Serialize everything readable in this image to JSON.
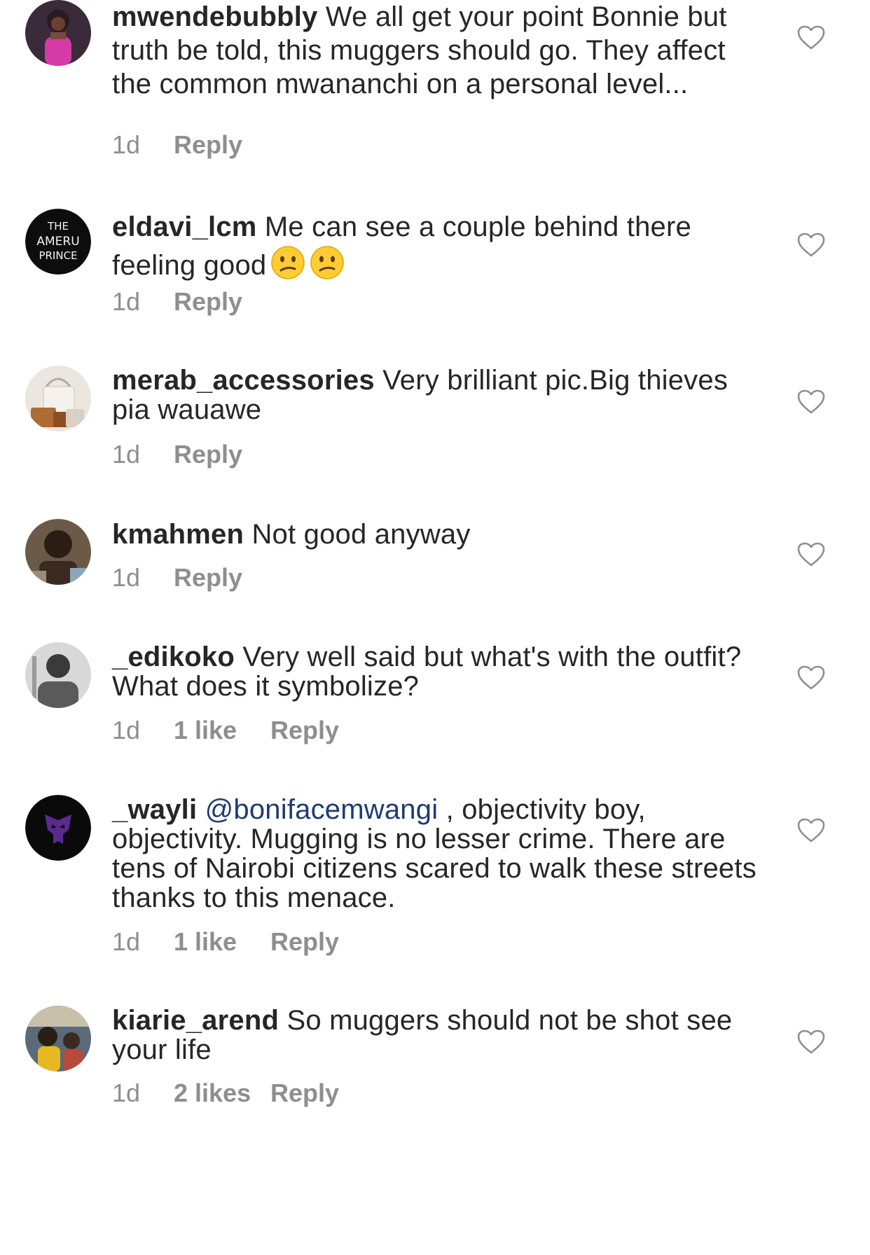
{
  "comments": [
    {
      "username": "mwendebubbly",
      "text": "We all get your point Bonnie but truth be told, this muggers should go. They affect the common mwananchi on a personal level...",
      "time": "1d",
      "reply": "Reply"
    },
    {
      "username": "eldavi_lcm",
      "text": "Me can see a couple behind there feeling good",
      "emoji": [
        "confused-face",
        "confused-face"
      ],
      "avatar_text": [
        "THE",
        "AMERU",
        "PRINCE"
      ],
      "time": "1d",
      "reply": "Reply"
    },
    {
      "username": "merab_accessories",
      "text": "Very brilliant pic.Big thieves pia wauawe",
      "time": "1d",
      "reply": "Reply"
    },
    {
      "username": "kmahmen",
      "text": "Not good anyway",
      "time": "1d",
      "reply": "Reply"
    },
    {
      "username": "_edikoko",
      "text": "Very well said but what's with the outfit? What does it symbolize?",
      "time": "1d",
      "likes": "1 like",
      "reply": "Reply"
    },
    {
      "username": "_wayli",
      "mention": "@bonifacemwangi",
      "text": ", objectivity boy, objectivity. Mugging is no lesser crime. There are tens of Nairobi citizens scared to walk these streets thanks to this menace.",
      "time": "1d",
      "likes": "1 like",
      "reply": "Reply"
    },
    {
      "username": "kiarie_arend",
      "text": "So muggers should not be shot see your life",
      "time": "1d",
      "likes": "2 likes",
      "reply": "Reply"
    }
  ],
  "colors": {
    "text": "#262626",
    "meta": "#8e8e8e",
    "mention": "#1e3b74",
    "heart": "#8e8e8e"
  },
  "icons": {
    "like": "heart-outline-icon",
    "emoji": "confused-face-icon"
  }
}
